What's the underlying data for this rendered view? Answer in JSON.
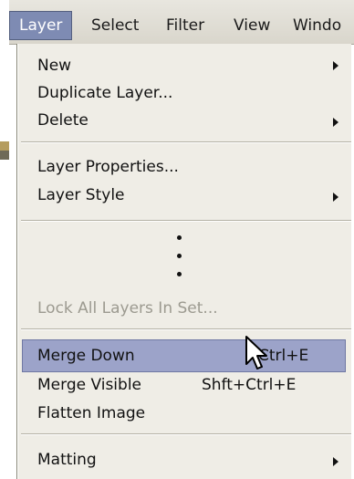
{
  "menubar": {
    "items": [
      {
        "label": "Layer"
      },
      {
        "label": "Select"
      },
      {
        "label": "Filter"
      },
      {
        "label": "View"
      },
      {
        "label": "Windo"
      }
    ],
    "active_item": "Layer"
  },
  "menu": {
    "new": {
      "label": "New",
      "has_submenu": true
    },
    "duplicate": {
      "label": "Duplicate Layer..."
    },
    "delete": {
      "label": "Delete",
      "has_submenu": true
    },
    "properties": {
      "label": "Layer Properties..."
    },
    "style": {
      "label": "Layer Style",
      "has_submenu": true
    },
    "lock": {
      "label": "Lock All Layers In Set...",
      "disabled": true
    },
    "merge_down": {
      "label": "Merge Down",
      "shortcut": "Ctrl+E",
      "highlighted": true
    },
    "merge_visible": {
      "label": "Merge Visible",
      "shortcut": "Shft+Ctrl+E"
    },
    "flatten": {
      "label": "Flatten Image"
    },
    "matting": {
      "label": "Matting",
      "has_submenu": true
    }
  },
  "colors": {
    "menubar_bg": "#dcd9cf",
    "active_menu_bg": "#7e8bb3",
    "dropdown_bg": "#efede6",
    "highlight_bg": "#9ca3c9",
    "disabled_text": "#9c9a90"
  },
  "icons": {
    "submenu": "submenu-arrow-icon",
    "cursor": "mouse-pointer-icon"
  }
}
